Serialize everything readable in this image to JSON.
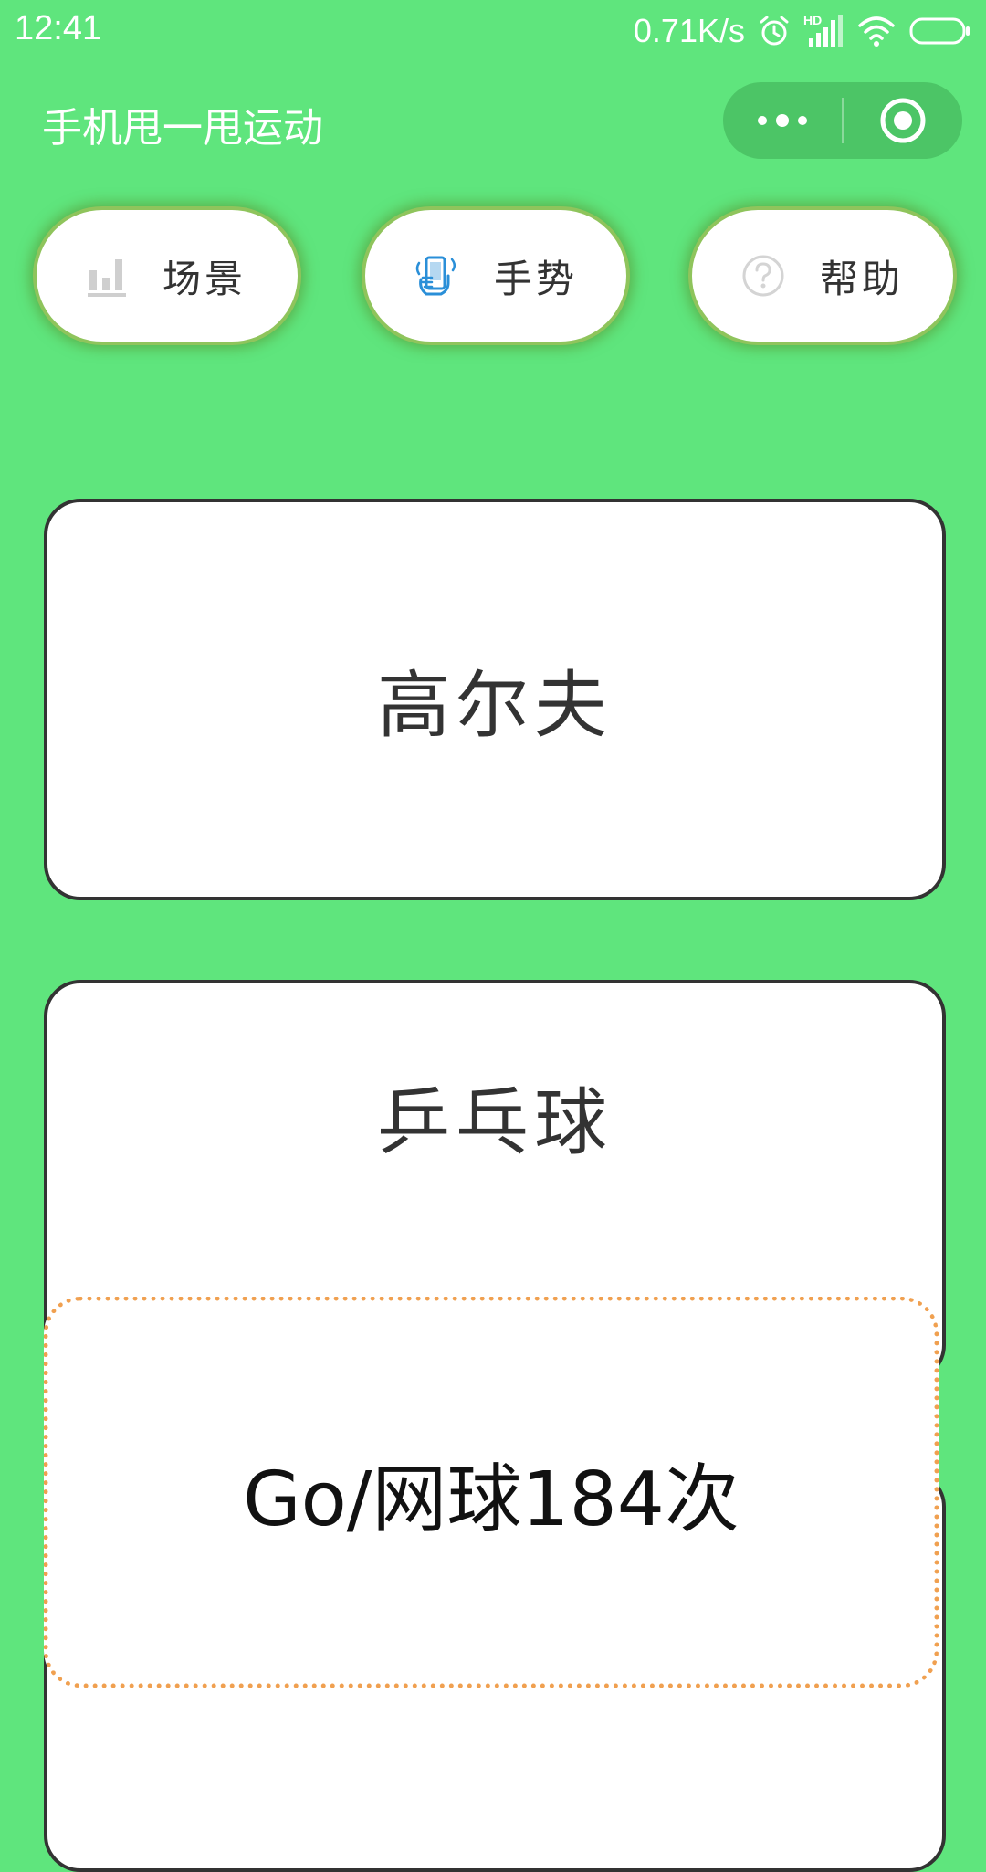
{
  "status_bar": {
    "time": "12:41",
    "net_speed": "0.71K/s",
    "icons": [
      "alarm-icon",
      "hd-signal-icon",
      "wifi-icon",
      "battery-icon"
    ],
    "network_badge": "HD"
  },
  "title_bar": {
    "title": "手机甩一甩运动",
    "more_icon": "more-dots-icon",
    "close_icon": "target-close-icon"
  },
  "tabs": [
    {
      "label": "场景",
      "icon": "bar-chart-icon"
    },
    {
      "label": "手势",
      "icon": "phone-shake-hand-icon"
    },
    {
      "label": "帮助",
      "icon": "question-circle-icon"
    }
  ],
  "sports": [
    {
      "label": "高尔夫"
    },
    {
      "label": "乒乓球"
    }
  ],
  "toast": {
    "text": "Go/网球184次"
  },
  "colors": {
    "background": "#5fe57d",
    "capsule": "#4cc566",
    "tab_border": "#8fc45c",
    "card_border": "#333333",
    "toast_border": "#f0a050",
    "gesture_icon": "#2a8fd8"
  }
}
